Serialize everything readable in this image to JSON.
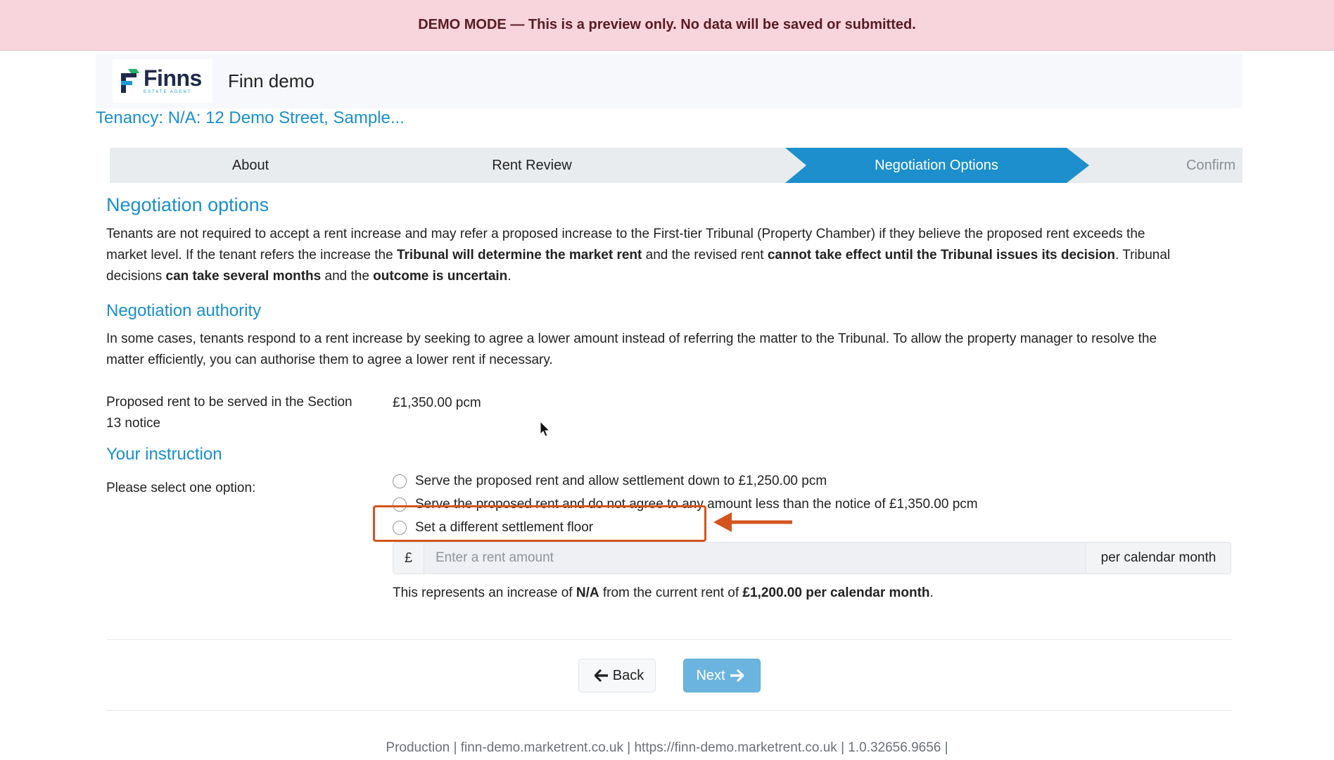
{
  "banner": {
    "text": "DEMO MODE — This is a preview only. No data will be saved or submitted."
  },
  "header": {
    "logo_name": "Finns",
    "logo_sub": "ESTATE AGENT",
    "org_name": "Finn demo"
  },
  "tenancy": {
    "title": "Tenancy: N/A: 12 Demo Street, Sample..."
  },
  "steps": [
    {
      "label": "About",
      "state": "done"
    },
    {
      "label": "Rent Review",
      "state": "done"
    },
    {
      "label": "Negotiation Options",
      "state": "active"
    },
    {
      "label": "Confirm",
      "state": "pending"
    }
  ],
  "negotiation_options": {
    "heading": "Negotiation options",
    "p1": "Tenants are not required to accept a rent increase and may refer a proposed increase to the First-tier Tribunal (Property Chamber) if they believe the proposed rent exceeds the",
    "p2a": "market level. If the tenant refers the increase the ",
    "p2b": "Tribunal will determine the market rent",
    "p2c": " and the revised rent ",
    "p2d": "cannot take effect until the Tribunal issues its decision",
    "p2e": ". Tribunal",
    "p3a": "decisions ",
    "p3b": "can take several months",
    "p3c": " and the ",
    "p3d": "outcome is uncertain",
    "p3e": "."
  },
  "negotiation_authority": {
    "heading": "Negotiation authority",
    "p1": "In some cases, tenants respond to a rent increase by seeking to agree a lower amount instead of referring the matter to the Tribunal. To allow the property manager to resolve the",
    "p2": "matter efficiently, you can authorise them to agree a lower rent if necessary."
  },
  "proposed_rent": {
    "label_line1": "Proposed rent to be served in the Section",
    "label_line2": "13 notice",
    "value": "£1,350.00 pcm"
  },
  "instruction": {
    "heading": "Your instruction",
    "prompt": "Please select one option:",
    "options": [
      "Serve the proposed rent and allow settlement down to £1,250.00 pcm",
      "Serve the proposed rent and do not agree to any amount less than the notice of £1,350.00 pcm",
      "Set a different settlement floor"
    ],
    "currency_prefix": "£",
    "amount_placeholder": "Enter a rent amount",
    "amount_suffix": "per calendar month",
    "increase_a": "This represents an increase of ",
    "increase_b": "N/A",
    "increase_c": " from the current rent of ",
    "increase_d": "£1,200.00 per calendar month",
    "increase_e": "."
  },
  "buttons": {
    "back": "Back",
    "next": "Next"
  },
  "footer": {
    "text": "Production | finn-demo.marketrent.co.uk | https://finn-demo.marketrent.co.uk | 1.0.32656.9656 |"
  },
  "colors": {
    "accent": "#1c8fcc",
    "highlight": "#d3541f",
    "banner_bg": "#f8d4dc"
  }
}
